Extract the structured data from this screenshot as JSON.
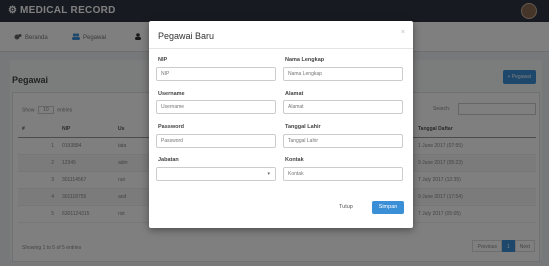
{
  "app": {
    "title": "MEDICAL RECORD"
  },
  "nav": {
    "items": [
      "Beranda",
      "Pegawai"
    ]
  },
  "panel": {
    "title": "Pegawai",
    "add_label": "+ Pegawai"
  },
  "table_controls": {
    "show": "Show",
    "entries_value": "10",
    "entries": "entries",
    "search_label": "Search:"
  },
  "table": {
    "headers": [
      "#",
      "NIP",
      "Us",
      "",
      "Tanggal Daftar"
    ],
    "rows": [
      {
        "no": "1",
        "nip": "0193884",
        "user": "tata",
        "date": "1 June 2017 (07:55)"
      },
      {
        "no": "2",
        "nip": "12345",
        "user": "adm",
        "date": "9 June 2017 (05:23)"
      },
      {
        "no": "3",
        "nip": "301114567",
        "user": "nut",
        "date": "7 July 2017 (12:35)"
      },
      {
        "no": "4",
        "nip": "301118755",
        "user": "and",
        "date": "9 June 2017 (17:54)"
      },
      {
        "no": "5",
        "nip": "6301124315",
        "user": "rist",
        "date": "7 July 2017 (05:05)"
      }
    ]
  },
  "footer": {
    "showing": "Showing 1 to 5 of 5 entries",
    "prev": "Previous",
    "page": "1",
    "next": "Next"
  },
  "modal": {
    "title": "Pegawai Baru",
    "close_x": "×",
    "fields": {
      "nip": {
        "label": "NIP",
        "placeholder": "NIP"
      },
      "nama": {
        "label": "Nama Lengkap",
        "placeholder": "Nama Lengkap"
      },
      "username": {
        "label": "Username",
        "placeholder": "Username"
      },
      "alamat": {
        "label": "Alamat",
        "placeholder": "Alamat"
      },
      "password": {
        "label": "Password",
        "placeholder": "Password"
      },
      "tgl": {
        "label": "Tanggal Lahir",
        "placeholder": "Tanggal Lahir"
      },
      "jabatan": {
        "label": "Jabatan",
        "value": ""
      },
      "kontak": {
        "label": "Kontak",
        "placeholder": "Kontak"
      }
    },
    "close_label": "Tutup",
    "save_label": "Simpan"
  },
  "colors": {
    "primary": "#3b8fd6",
    "topbar": "#2f3742",
    "danger": "#d9534f"
  }
}
